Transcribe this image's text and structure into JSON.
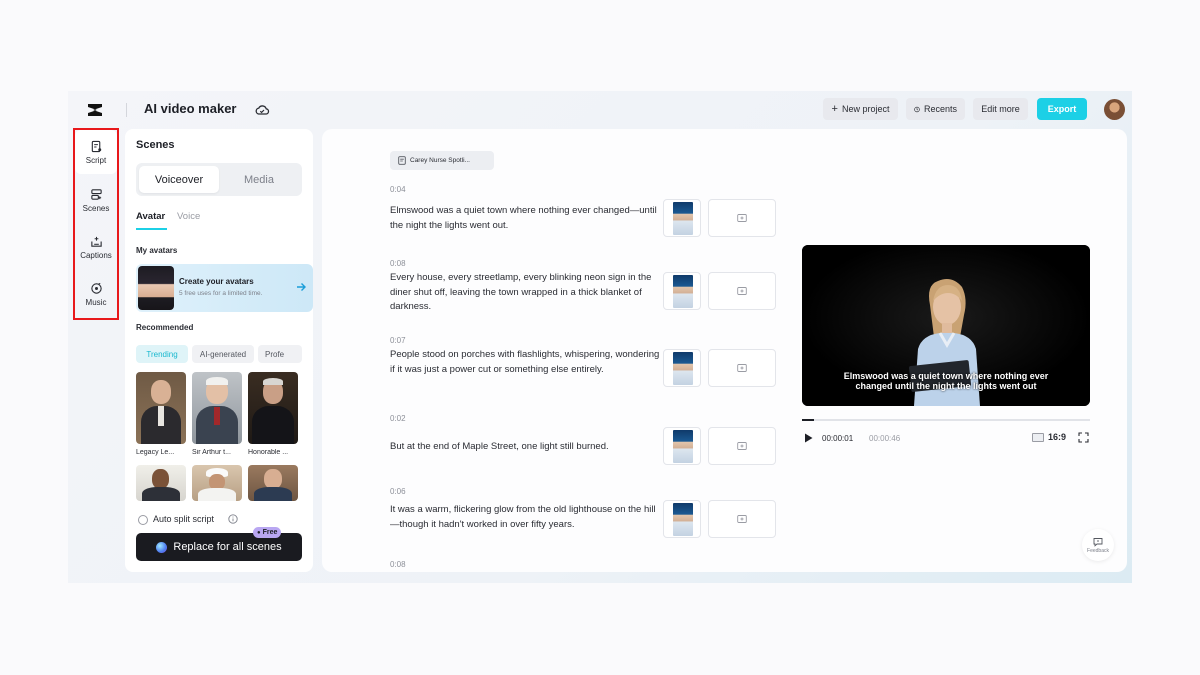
{
  "header": {
    "title": "AI video maker",
    "new_project": "New project",
    "recents": "Recents",
    "edit_more": "Edit more",
    "export": "Export",
    "accent_color": "#1cd0e6"
  },
  "rail": {
    "items": [
      {
        "label": "Script",
        "icon": "script-icon"
      },
      {
        "label": "Scenes",
        "icon": "scenes-icon"
      },
      {
        "label": "Captions",
        "icon": "captions-icon"
      },
      {
        "label": "Music",
        "icon": "music-icon"
      }
    ],
    "highlight_color": "#e8181b"
  },
  "scenes_panel": {
    "title": "Scenes",
    "tabs": [
      "Voiceover",
      "Media"
    ],
    "subtabs": [
      "Avatar",
      "Voice"
    ],
    "my_avatars_label": "My avatars",
    "create_title": "Create your avatars",
    "create_sub": "5 free uses for a limited time.",
    "recommended_label": "Recommended",
    "chips": [
      "Trending",
      "AI-generated",
      "Profe"
    ],
    "avatars": [
      {
        "name": "Legacy Le..."
      },
      {
        "name": "Sir Arthur t..."
      },
      {
        "name": "Honorable ..."
      }
    ],
    "auto_split_label": "Auto split script",
    "replace_label": "Replace for all scenes",
    "free_badge": "Free"
  },
  "script": {
    "file_chip": "Carey Nurse Spotli...",
    "scenes": [
      {
        "time": "0:04",
        "text": "Elmswood was a quiet town where nothing ever changed—until the night the lights went out."
      },
      {
        "time": "0:08",
        "text": "Every house, every streetlamp, every blinking neon sign in the diner shut off, leaving the town wrapped in a thick blanket of darkness."
      },
      {
        "time": "0:07",
        "text": "People stood on porches with flashlights, whispering, wondering if it was just a power cut or something else entirely."
      },
      {
        "time": "0:02",
        "text": "But at the end of Maple Street, one light still burned."
      },
      {
        "time": "0:06",
        "text": "It was a warm, flickering glow from the old lighthouse on the hill—though it hadn't worked in over fifty years."
      },
      {
        "time": "0:08",
        "text": ""
      }
    ]
  },
  "preview": {
    "caption_line1": "Elmswood was a quiet town where nothing ever",
    "caption_line2": "changed until the night the lights went out",
    "current_time": "00:00:01",
    "total_time": "00:00:46",
    "progress": 0.04,
    "aspect_ratio": "16:9",
    "feedback": "Feedback"
  }
}
